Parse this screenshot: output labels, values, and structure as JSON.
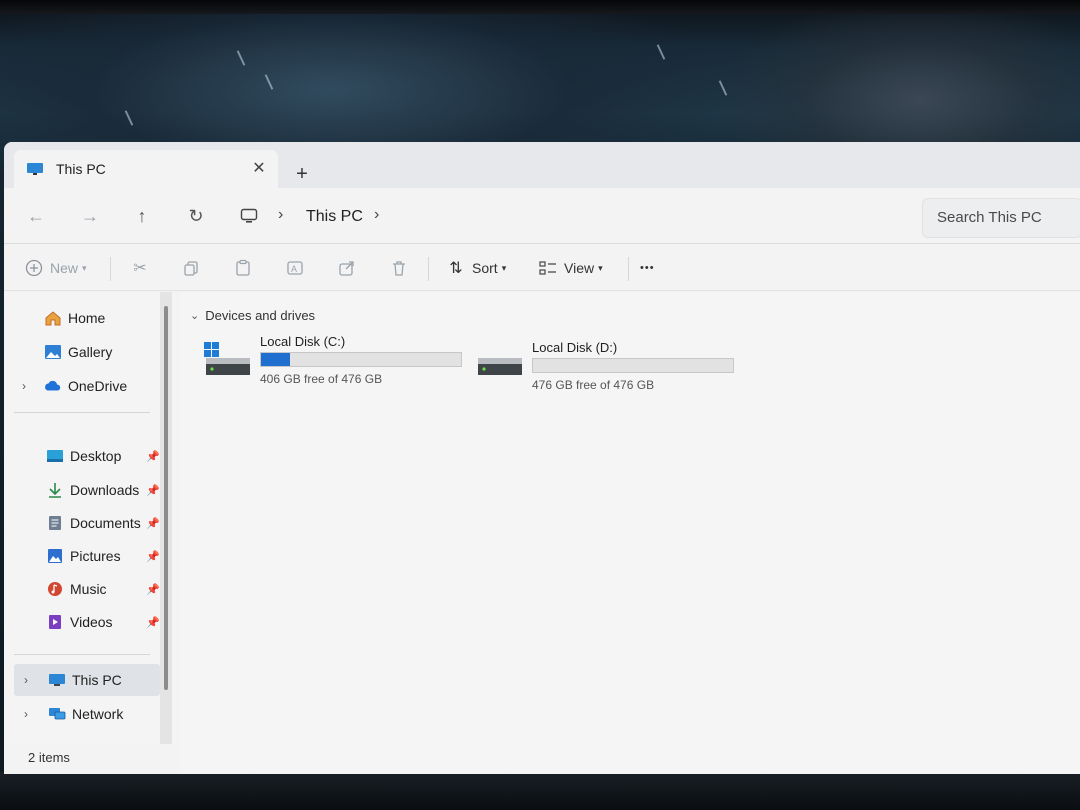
{
  "window": {
    "tab_title": "This PC",
    "new_tab": "+",
    "close": "✕"
  },
  "nav": {
    "back": "←",
    "forward": "→",
    "up": "↑",
    "refresh": "↻",
    "breadcrumb": "This PC",
    "search_placeholder": "Search This PC"
  },
  "commands": {
    "new_label": "New",
    "sort_label": "Sort",
    "view_label": "View",
    "more": "•••"
  },
  "sidebar": {
    "top": [
      {
        "label": "Home",
        "icon": "home-icon"
      },
      {
        "label": "Gallery",
        "icon": "gallery-icon"
      },
      {
        "label": "OneDrive",
        "icon": "onedrive-icon",
        "expandable": true
      }
    ],
    "pinned": [
      {
        "label": "Desktop",
        "icon": "desktop-icon"
      },
      {
        "label": "Downloads",
        "icon": "downloads-icon"
      },
      {
        "label": "Documents",
        "icon": "documents-icon"
      },
      {
        "label": "Pictures",
        "icon": "pictures-icon"
      },
      {
        "label": "Music",
        "icon": "music-icon"
      },
      {
        "label": "Videos",
        "icon": "videos-icon"
      }
    ],
    "bottom": [
      {
        "label": "This PC",
        "icon": "this-pc-icon",
        "selected": true
      },
      {
        "label": "Network",
        "icon": "network-icon"
      }
    ]
  },
  "content": {
    "group_label": "Devices and drives",
    "drives": [
      {
        "name": "Local Disk (C:)",
        "free_text": "406 GB free of 476 GB",
        "used_fraction": 0.147,
        "system": true
      },
      {
        "name": "Local Disk (D:)",
        "free_text": "476 GB free of 476 GB",
        "used_fraction": 0.0,
        "system": false
      }
    ]
  },
  "status": {
    "items_text": "2 items"
  },
  "colors": {
    "accent": "#1f6fd1",
    "window_bg": "#f3f3f4"
  }
}
